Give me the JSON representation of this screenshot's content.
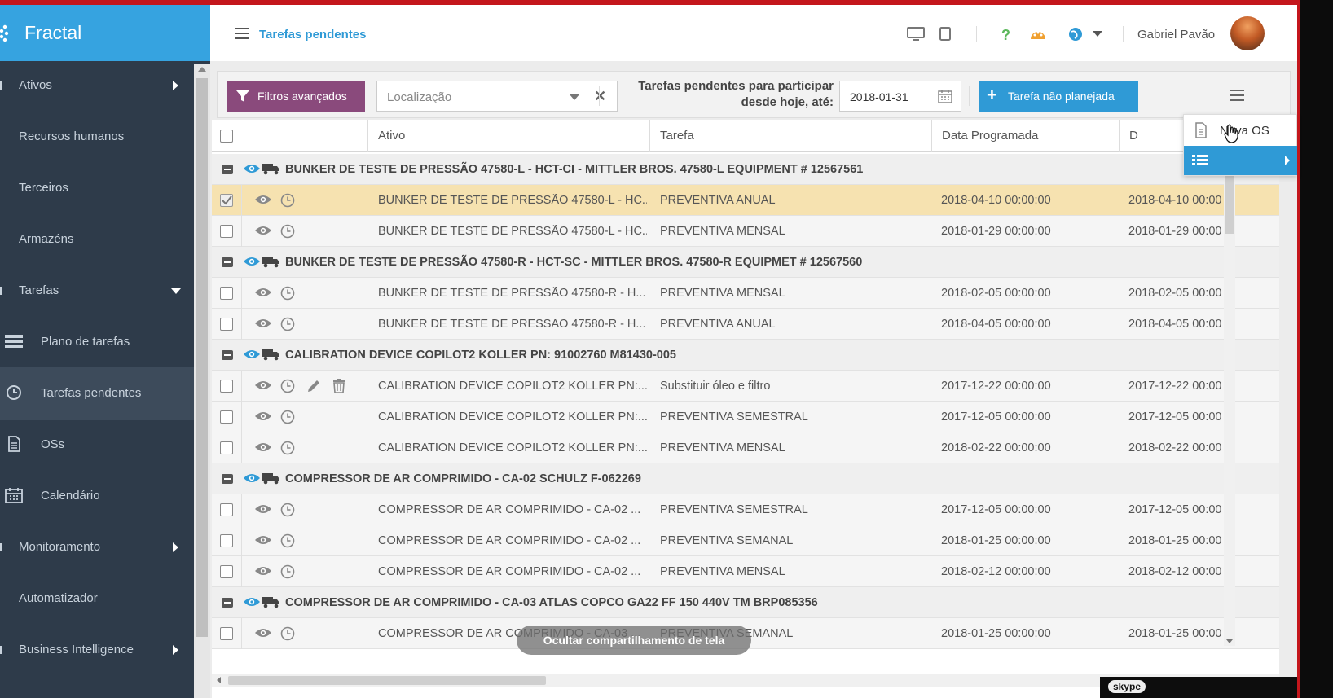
{
  "app": {
    "brand": "Fractal",
    "page_title": "Tarefas pendentes",
    "user_name": "Gabriel Pavão"
  },
  "sidebar": {
    "items": [
      {
        "label": "Ativos"
      },
      {
        "label": "Recursos humanos"
      },
      {
        "label": "Terceiros"
      },
      {
        "label": "Armazéns"
      },
      {
        "label": "Tarefas"
      },
      {
        "label": "Plano de tarefas"
      },
      {
        "label": "Tarefas pendentes"
      },
      {
        "label": "OSs"
      },
      {
        "label": "Calendário"
      },
      {
        "label": "Monitoramento"
      },
      {
        "label": "Automatizador"
      },
      {
        "label": "Business Intelligence"
      }
    ]
  },
  "toolbar": {
    "filters_label": "Filtros avançados",
    "location_placeholder": "Localização",
    "date_label_line1": "Tarefas pendentes para participar",
    "date_label_line2": "desde hoje, até:",
    "date_value": "2018-01-31",
    "unplanned_label": "Tarefa não planejada"
  },
  "popup": {
    "new_os_label": "Nova OS"
  },
  "grid": {
    "columns": [
      "Ativo",
      "Tarefa",
      "Data Programada",
      "D"
    ],
    "groups": [
      {
        "title": "BUNKER DE TESTE DE PRESSÃO 47580-L - HCT-CI - MITTLER BROS. 47580-L EQUIPMENT # 12567561",
        "rows": [
          {
            "ativo": "BUNKER DE TESTE DE PRESSÃO 47580-L - HC...",
            "tarefa": "PREVENTIVA ANUAL",
            "data": "2018-04-10 00:00:00",
            "d": "2018-04-10 00:00",
            "selected": true
          },
          {
            "ativo": "BUNKER DE TESTE DE PRESSÃO 47580-L - HC...",
            "tarefa": "PREVENTIVA MENSAL",
            "data": "2018-01-29 00:00:00",
            "d": "2018-01-29 00:00"
          }
        ]
      },
      {
        "title": "BUNKER DE TESTE DE PRESSÃO 47580-R - HCT-SC - MITTLER BROS. 47580-R EQUIPMET # 12567560",
        "rows": [
          {
            "ativo": "BUNKER DE TESTE DE PRESSÃO 47580-R - H...",
            "tarefa": "PREVENTIVA MENSAL",
            "data": "2018-02-05 00:00:00",
            "d": "2018-02-05 00:00"
          },
          {
            "ativo": "BUNKER DE TESTE DE PRESSÃO 47580-R - H...",
            "tarefa": "PREVENTIVA ANUAL",
            "data": "2018-04-05 00:00:00",
            "d": "2018-04-05 00:00"
          }
        ]
      },
      {
        "title": "CALIBRATION DEVICE COPILOT2 KOLLER PN: 91002760 M81430-005",
        "rows": [
          {
            "ativo": "CALIBRATION DEVICE COPILOT2 KOLLER PN:...",
            "tarefa": "Substituir óleo e filtro",
            "data": "2017-12-22 00:00:00",
            "d": "2017-12-22 00:00",
            "editable": true
          },
          {
            "ativo": "CALIBRATION DEVICE COPILOT2 KOLLER PN:...",
            "tarefa": "PREVENTIVA SEMESTRAL",
            "data": "2017-12-05 00:00:00",
            "d": "2017-12-05 00:00"
          },
          {
            "ativo": "CALIBRATION DEVICE COPILOT2 KOLLER PN:...",
            "tarefa": "PREVENTIVA MENSAL",
            "data": "2018-02-22 00:00:00",
            "d": "2018-02-22 00:00"
          }
        ]
      },
      {
        "title": "COMPRESSOR DE AR COMPRIMIDO - CA-02 SCHULZ F-062269",
        "rows": [
          {
            "ativo": "COMPRESSOR DE AR COMPRIMIDO - CA-02 ...",
            "tarefa": "PREVENTIVA SEMESTRAL",
            "data": "2017-12-05 00:00:00",
            "d": "2017-12-05 00:00"
          },
          {
            "ativo": "COMPRESSOR DE AR COMPRIMIDO - CA-02 ...",
            "tarefa": "PREVENTIVA SEMANAL",
            "data": "2018-01-25 00:00:00",
            "d": "2018-01-25 00:00"
          },
          {
            "ativo": "COMPRESSOR DE AR COMPRIMIDO - CA-02 ...",
            "tarefa": "PREVENTIVA MENSAL",
            "data": "2018-02-12 00:00:00",
            "d": "2018-02-12 00:00"
          }
        ]
      },
      {
        "title": "COMPRESSOR DE AR COMPRIMIDO - CA-03 ATLAS COPCO GA22 FF 150 440V TM BRP085356",
        "rows": [
          {
            "ativo": "COMPRESSOR DE AR COMPRIMIDO - CA-03 ...",
            "tarefa": "PREVENTIVA SEMANAL",
            "data": "2018-01-25 00:00:00",
            "d": "2018-01-25 00:00"
          }
        ]
      }
    ]
  },
  "overlay": {
    "share_label": "Ocultar compartilhamento de tela",
    "skype_label": "skype"
  },
  "colors": {
    "brand": "#36a3e0",
    "sidebar": "#2e3b4a",
    "filter_button": "#8a4a7c",
    "primary": "#2f9ad6",
    "selected_row": "#f6e2b0"
  }
}
